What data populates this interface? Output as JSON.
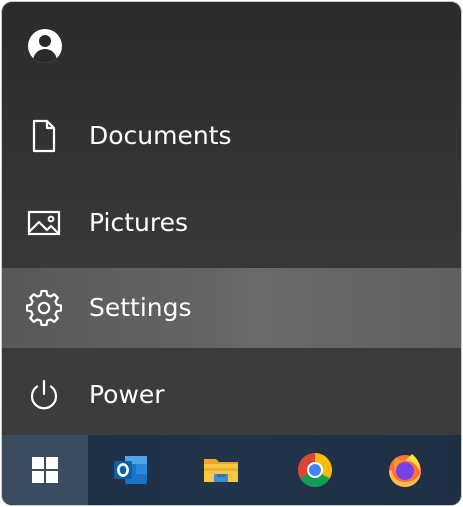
{
  "start_menu": {
    "user": {
      "icon": "user-avatar-icon"
    },
    "items": [
      {
        "id": "documents",
        "label": "Documents",
        "icon": "document-icon",
        "selected": false
      },
      {
        "id": "pictures",
        "label": "Pictures",
        "icon": "picture-icon",
        "selected": false
      },
      {
        "id": "settings",
        "label": "Settings",
        "icon": "gear-icon",
        "selected": true
      },
      {
        "id": "power",
        "label": "Power",
        "icon": "power-icon",
        "selected": false
      }
    ]
  },
  "taskbar": {
    "buttons": [
      {
        "id": "start",
        "icon": "windows-logo-icon",
        "active": true
      },
      {
        "id": "outlook",
        "icon": "outlook-icon",
        "active": false
      },
      {
        "id": "file-explorer",
        "icon": "file-explorer-icon",
        "active": false
      },
      {
        "id": "chrome",
        "icon": "chrome-icon",
        "active": false
      },
      {
        "id": "firefox",
        "icon": "firefox-icon",
        "active": false
      }
    ]
  },
  "colors": {
    "menu_background": "#333333",
    "selected_item": "#616161",
    "taskbar_background": "#22344a",
    "start_button_active": "#3b4c60",
    "text": "#ffffff"
  }
}
